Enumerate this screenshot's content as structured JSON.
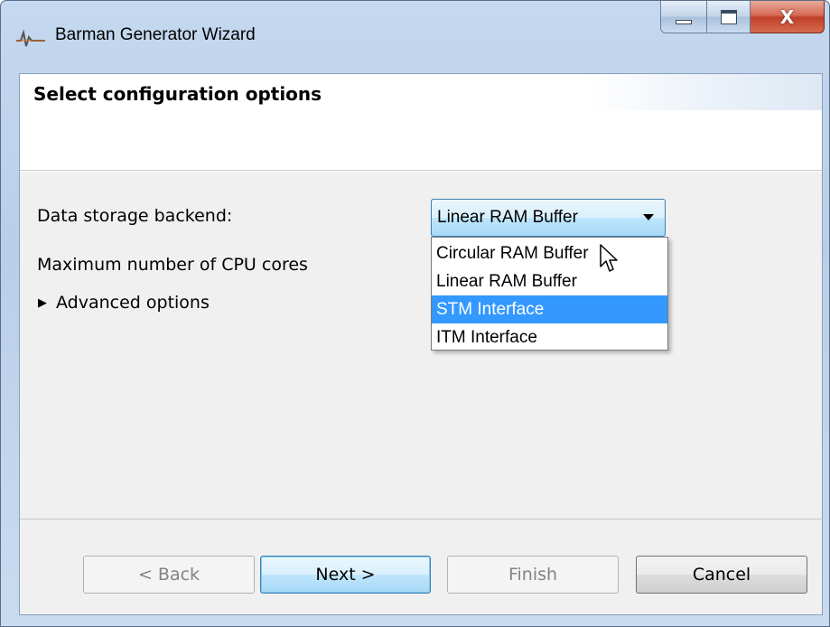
{
  "window": {
    "title": "Barman Generator Wizard",
    "icon": "wizard-app-icon",
    "caption_buttons": [
      "minimize",
      "maximize",
      "close"
    ],
    "close_glyph": "X"
  },
  "header": {
    "title": "Select configuration options"
  },
  "form": {
    "storage_label": "Data storage backend:",
    "storage_selected": "Linear RAM Buffer",
    "cores_label": "Maximum number of CPU cores",
    "advanced_label": "Advanced options",
    "storage_options": [
      {
        "label": "Circular RAM Buffer"
      },
      {
        "label": "Linear RAM Buffer"
      },
      {
        "label": "STM Interface"
      },
      {
        "label": "ITM Interface"
      }
    ],
    "highlighted_option": "STM Interface"
  },
  "footer": {
    "back_label": "< Back",
    "next_label": "Next >",
    "finish_label": "Finish",
    "cancel_label": "Cancel"
  },
  "colors": {
    "selection": "#3399ff",
    "frame": "#b9cfe9",
    "close_button": "#c0402a"
  }
}
